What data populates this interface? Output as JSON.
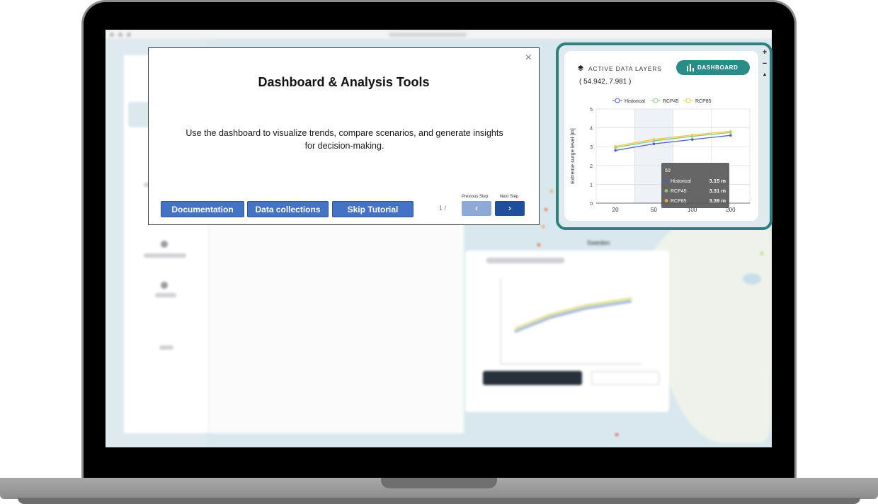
{
  "dialog": {
    "title": "Dashboard & Analysis Tools",
    "body": "Use the dashboard to visualize trends, compare scenarios, and generate insights for decision-making.",
    "close_label": "×",
    "buttons": {
      "documentation": "Documentation",
      "data_collections": "Data collections",
      "skip": "Skip Tutorial"
    },
    "pager": "1 /",
    "prev_label": "Previous Step",
    "next_label": "Next Step",
    "prev_icon": "‹",
    "next_icon": "›"
  },
  "dashboard": {
    "tab_layers": "ACTIVE DATA LAYERS",
    "tab_dashboard": "DASHBOARD",
    "coordinates": "( 54.942, 7.981 )",
    "map_controls": [
      "+",
      "−",
      "▲"
    ],
    "accent": "#2a8c87",
    "highlight_color": "#2f7f7f"
  },
  "map": {
    "label": "Sweden"
  },
  "chart_data": {
    "type": "line",
    "categories": [
      "20",
      "50",
      "100",
      "200"
    ],
    "ylabel": "Extreme surge level [m]",
    "xlabel": "",
    "ylim": [
      0,
      5
    ],
    "yticks": [
      "0",
      "1",
      "2",
      "3",
      "4",
      "5"
    ],
    "series": [
      {
        "name": "Historical",
        "color": "#4a63c9",
        "values": [
          2.8,
          3.15,
          3.38,
          3.6
        ]
      },
      {
        "name": "RCP45",
        "color": "#8cc97a",
        "values": [
          2.95,
          3.31,
          3.55,
          3.75
        ]
      },
      {
        "name": "RCP85",
        "color": "#f2c94c",
        "values": [
          3.02,
          3.39,
          3.62,
          3.82
        ]
      }
    ],
    "tooltip": {
      "title": "50",
      "rows": [
        {
          "name": "Historical",
          "value": "3.15 m",
          "color": "#4a63c9"
        },
        {
          "name": "RCP45",
          "value": "3.31 m",
          "color": "#8cc97a"
        },
        {
          "name": "RCP85",
          "value": "3.39 m",
          "color": "#f2a93b"
        }
      ]
    },
    "legend": "top",
    "grid": true
  }
}
